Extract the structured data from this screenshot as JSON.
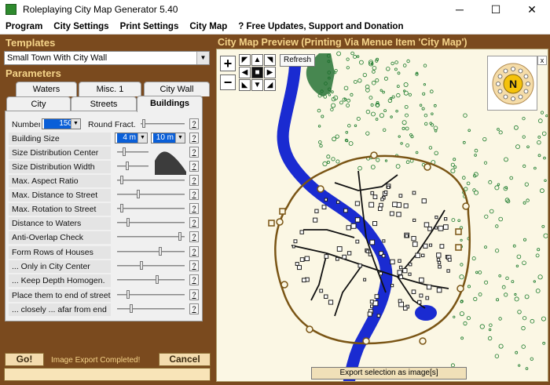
{
  "window": {
    "title": "Roleplaying City Map Generator 5.40",
    "minimize": "─",
    "maximize": "☐",
    "close": "✕"
  },
  "menu": [
    "Program",
    "City Settings",
    "Print Settings",
    "City Map",
    "? Free Updates, Support and Donation"
  ],
  "templates": {
    "heading": "Templates",
    "selected": "Small Town With City Wall"
  },
  "parameters": {
    "heading": "Parameters",
    "tabs_back": [
      "Waters",
      "Misc. 1",
      "City Wall"
    ],
    "tabs_front": [
      "City",
      "Streets",
      "Buildings"
    ],
    "active_tab": "Buildings",
    "number_label": "Number",
    "number_value": "150",
    "round_fract_label": "Round Fract.",
    "building_size_label": "Building Size",
    "building_size_min": "4 m",
    "building_size_max": "10 m",
    "rows": [
      {
        "label": "Size Distribution Center",
        "value": 0.2
      },
      {
        "label": "Size Distribution Width",
        "value": 0.3
      },
      {
        "label": "Max. Aspect Ratio",
        "value": 0.05
      },
      {
        "label": "Max. Distance to Street",
        "value": 0.3
      },
      {
        "label": "Max. Rotation to Street",
        "value": 0.05
      },
      {
        "label": "Distance to Waters",
        "value": 0.15
      },
      {
        "label": "Anti-Overlap Check",
        "value": 0.95
      },
      {
        "label": "Form Rows of Houses",
        "value": 0.65
      },
      {
        "label": "... Only in City Center",
        "value": 0.35
      },
      {
        "label": "... Keep Depth Homogen.",
        "value": 0.6
      },
      {
        "label": "Place them to end of streets",
        "value": 0.15
      },
      {
        "label": "... closely ... afar from end",
        "value": 0.2
      }
    ],
    "help": "?"
  },
  "go_button": "Go!",
  "status_text": "Image Export Completed!",
  "cancel_button": "Cancel",
  "preview": {
    "heading": "City Map Preview (Printing Via Menue Item 'City Map')",
    "refresh": "Refresh",
    "export": "Export selection as image[s]",
    "compass_letter": "N",
    "close": "x"
  },
  "colors": {
    "frame": "#7a4a1e",
    "heading": "#f5d48a",
    "river": "#1a2bd1",
    "wall": "#7a5515",
    "trees": "#1a7a2a"
  }
}
